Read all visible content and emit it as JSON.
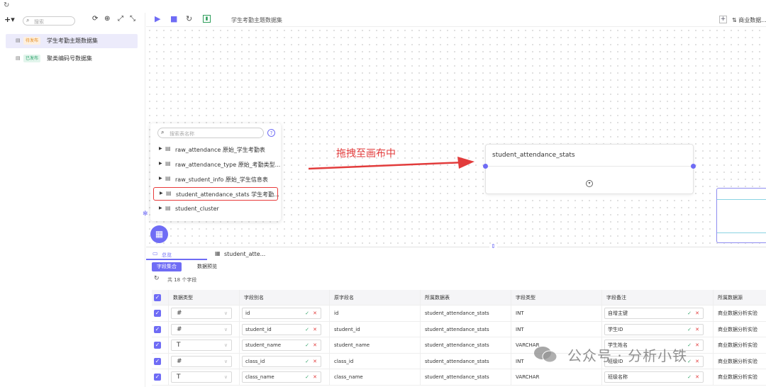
{
  "toolbar_top": {
    "refresh_icon": "refresh-icon"
  },
  "sidebar": {
    "search_placeholder": "搜索",
    "items": [
      {
        "status": "待发布",
        "name": "学生考勤主题数据集",
        "active": true
      },
      {
        "status": "已发布",
        "name": "聚类编码号数据集",
        "active": false
      }
    ]
  },
  "main_toolbar": {
    "title": "学生考勤主题数据集",
    "dataset_label": "商业数据..."
  },
  "table_panel": {
    "search_placeholder": "搜索表名称",
    "help": "?",
    "tables": [
      {
        "name": "raw_attendance  原始_学生考勤表"
      },
      {
        "name": "raw_attendance_type  原始_考勤类型..."
      },
      {
        "name": "raw_student_info  原始_学生信息表"
      },
      {
        "name": "student_attendance_stats  学生考勤..."
      },
      {
        "name": "student_cluster"
      }
    ]
  },
  "annotation": {
    "drag_hint": "拖拽至画布中"
  },
  "node": {
    "title": "student_attendance_stats"
  },
  "bottom_panel": {
    "tab_total": "总览",
    "tab_table": "student_atte...",
    "subtab_fields": "字段集合",
    "subtab_preview": "数据预览",
    "field_count": "共 18 个字段",
    "columns": [
      "数据类型",
      "字段别名",
      "原字段名",
      "所属数据表",
      "字段类型",
      "字段备注",
      "所属数据源"
    ],
    "rows": [
      {
        "type": "#",
        "alias": "id",
        "orig": "id",
        "table": "student_attendance_stats",
        "ftype": "INT",
        "note": "自增主键",
        "source": "商业数据分析实验"
      },
      {
        "type": "#",
        "alias": "student_id",
        "orig": "student_id",
        "table": "student_attendance_stats",
        "ftype": "INT",
        "note": "学生ID",
        "source": "商业数据分析实验"
      },
      {
        "type": "T",
        "alias": "student_name",
        "orig": "student_name",
        "table": "student_attendance_stats",
        "ftype": "VARCHAR",
        "note": "学生姓名",
        "source": "商业数据分析实验"
      },
      {
        "type": "#",
        "alias": "class_id",
        "orig": "class_id",
        "table": "student_attendance_stats",
        "ftype": "INT",
        "note": "班级ID",
        "source": "商业数据分析实验"
      },
      {
        "type": "T",
        "alias": "class_name",
        "orig": "class_name",
        "table": "student_attendance_stats",
        "ftype": "VARCHAR",
        "note": "班级名称",
        "source": "商业数据分析实验"
      }
    ]
  },
  "watermark": {
    "text": "公众号 · 分析小铁"
  },
  "colors": {
    "accent": "#6f6cf5",
    "arrow": "#e23c3c",
    "highlight": "#e83a3a"
  }
}
